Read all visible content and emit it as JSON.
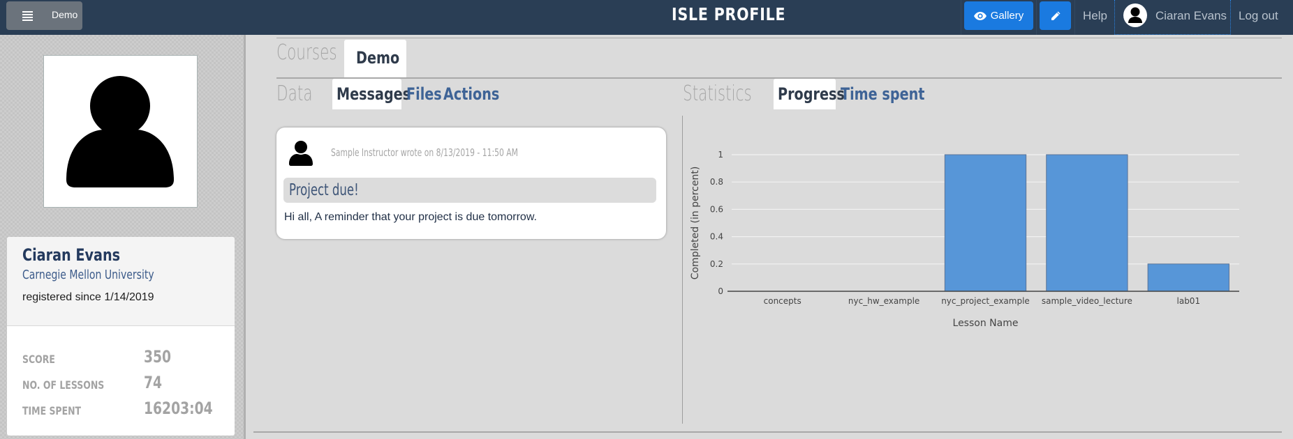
{
  "navbar": {
    "menu_label": "Demo",
    "title": "ISLE PROFILE",
    "gallery_label": "Gallery",
    "help_label": "Help",
    "user_name": "Ciaran Evans",
    "logout_label": "Log out",
    "accent_color": "#1a7ae0",
    "bg_color": "#2a3e55"
  },
  "profile": {
    "name": "Ciaran Evans",
    "organization": "Carnegie Mellon University",
    "registered": "registered since 1/14/2019",
    "stats": [
      {
        "label": "SCORE",
        "value": "350"
      },
      {
        "label": "NO. OF LESSONS",
        "value": "74"
      },
      {
        "label": "TIME SPENT",
        "value": "16203:04"
      }
    ]
  },
  "courses": {
    "section_label": "Courses",
    "tabs": [
      {
        "label": "Demo",
        "active": true
      }
    ]
  },
  "data_section": {
    "section_label": "Data",
    "tabs": [
      {
        "label": "Messages",
        "active": true
      },
      {
        "label": "Files",
        "active": false
      },
      {
        "label": "Actions",
        "active": false
      }
    ]
  },
  "statistics_section": {
    "section_label": "Statistics",
    "tabs": [
      {
        "label": "Progress",
        "active": true
      },
      {
        "label": "Time spent",
        "active": false
      }
    ]
  },
  "messages": [
    {
      "author_line": "Sample Instructor wrote on 8/13/2019 - 11:50 AM",
      "title": "Project due!",
      "body": "Hi all, A reminder that your project is due tomorrow."
    }
  ],
  "chart_data": {
    "type": "bar",
    "title": "",
    "xlabel": "Lesson Name",
    "ylabel": "Completed (in percent)",
    "categories": [
      "concepts",
      "nyc_hw_example",
      "nyc_project_example",
      "sample_video_lecture",
      "lab01"
    ],
    "values": [
      0,
      0,
      1,
      1,
      0.2
    ],
    "ylim": [
      0,
      1
    ],
    "yticks": [
      "0",
      "0.2",
      "0.4",
      "0.6",
      "0.8",
      "1"
    ],
    "grid": true,
    "bar_color": "#5796d8"
  }
}
